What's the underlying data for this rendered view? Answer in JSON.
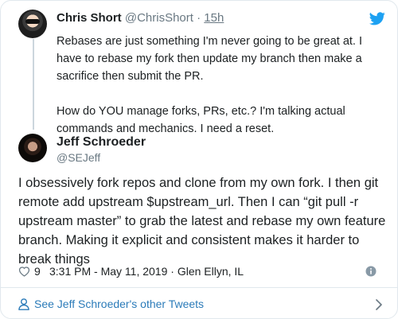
{
  "parent_tweet": {
    "author_name": "Chris Short",
    "handle": "@ChrisShort",
    "separator": "·",
    "time": "15h",
    "paragraphs": [
      "Rebases are just something I'm never going to be great at. I have to rebase my fork then update my branch then make a sacrifice then submit the PR.",
      "How do YOU manage forks, PRs, etc.? I'm talking actual commands and mechanics. I need a reset."
    ]
  },
  "tweet": {
    "author_name": "Jeff Schroeder",
    "handle": "@SEJeff",
    "text": "I obsessively fork repos and clone from my own fork. I then git remote add upstream $upstream_url. Then I can “git pull -r upstream master” to grab the latest and rebase my own feature branch. Making it explicit and consistent makes it harder to break things",
    "like_count": "9",
    "timestamp": "3:31 PM - May 11, 2019 · Glen Ellyn, IL"
  },
  "footer_link": {
    "label": "See Jeff Schroeder's other Tweets"
  },
  "icons": {
    "brand": "twitter-bird-icon",
    "like": "heart-icon",
    "info": "info-icon",
    "profile": "person-icon",
    "more": "chevron-right-icon"
  },
  "colors": {
    "twitter_blue": "#1da1f2",
    "link_blue": "#2b7bb9",
    "secondary_text": "#697882",
    "primary_text": "#1c2022",
    "border": "#e1e8ed",
    "thread_line": "#ccd6dd"
  }
}
